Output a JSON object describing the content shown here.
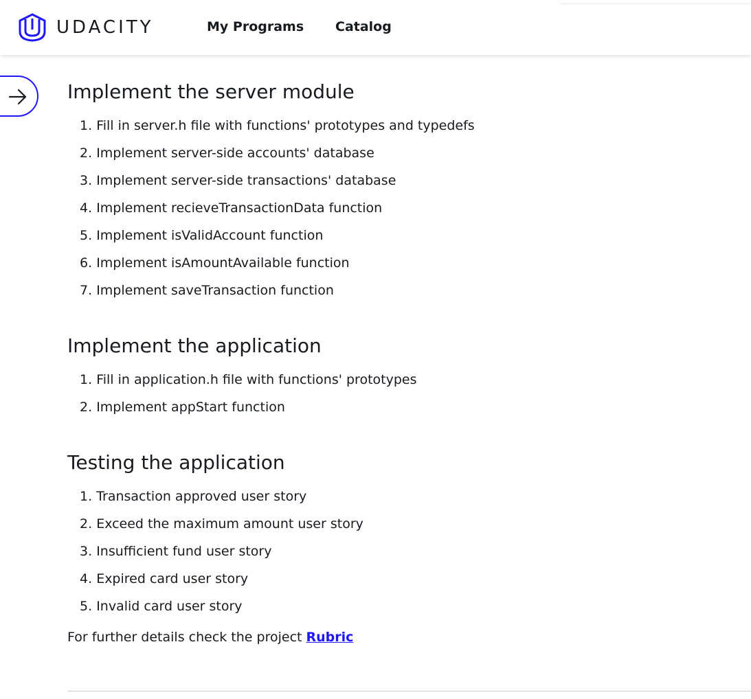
{
  "header": {
    "logo_text": "UDACITY",
    "nav": {
      "my_programs": "My Programs",
      "catalog": "Catalog"
    }
  },
  "sidebar_toggle": {
    "icon": "arrow-right-icon"
  },
  "sections": [
    {
      "title": "Implement the server module",
      "items": [
        {
          "num": "1.",
          "text": "Fill in server.h file with functions' prototypes and typedefs"
        },
        {
          "num": "2.",
          "text": "Implement server-side accounts' database"
        },
        {
          "num": "3.",
          "text": "Implement server-side transactions' database"
        },
        {
          "num": "4.",
          "text": "Implement recieveTransactionData function"
        },
        {
          "num": "5.",
          "text": "Implement isValidAccount function"
        },
        {
          "num": "6.",
          "text": "Implement isAmountAvailable function"
        },
        {
          "num": "7.",
          "text": "Implement saveTransaction function"
        }
      ]
    },
    {
      "title": "Implement the application",
      "items": [
        {
          "num": "1.",
          "text": "Fill in application.h file with functions' prototypes"
        },
        {
          "num": "2.",
          "text": "Implement appStart function"
        }
      ]
    },
    {
      "title": "Testing the application",
      "items": [
        {
          "num": "1.",
          "text": "Transaction approved user story"
        },
        {
          "num": "2.",
          "text": "Exceed the maximum amount user story"
        },
        {
          "num": "3.",
          "text": "Insufficient fund user story"
        },
        {
          "num": "4.",
          "text": "Expired card user story"
        },
        {
          "num": "5.",
          "text": "Invalid card user story"
        }
      ]
    }
  ],
  "footer_note": {
    "prefix": "For further details check the project ",
    "link_text": "Rubric"
  },
  "colors": {
    "brand": "#2015ff",
    "text": "#171a1f",
    "divider": "#c7c9cc"
  }
}
